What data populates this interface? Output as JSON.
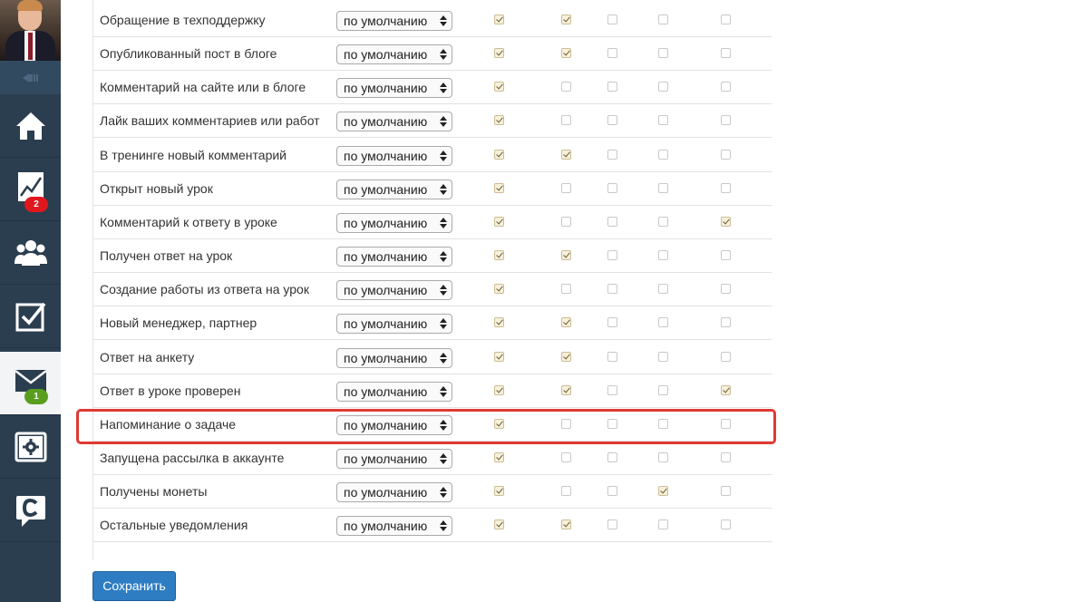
{
  "sidebar": {
    "badges": {
      "stats": "2",
      "messages": "1"
    },
    "items": [
      {
        "name": "home",
        "icon": "home-icon"
      },
      {
        "name": "statistics",
        "icon": "chart-icon"
      },
      {
        "name": "users",
        "icon": "users-icon"
      },
      {
        "name": "tasks",
        "icon": "checkbox-icon"
      },
      {
        "name": "messages",
        "icon": "envelope-icon"
      },
      {
        "name": "settings",
        "icon": "gear-screen-icon"
      },
      {
        "name": "chat",
        "icon": "chat-logo-icon"
      }
    ]
  },
  "notifications": {
    "rows": [
      {
        "label": "Обращение в техподдержку",
        "select": "по умолчанию",
        "checks": [
          true,
          true,
          false,
          false,
          false
        ]
      },
      {
        "label": "Опубликованный пост в блоге",
        "select": "по умолчанию",
        "checks": [
          true,
          true,
          false,
          false,
          false
        ]
      },
      {
        "label": "Комментарий на сайте или в блоге",
        "select": "по умолчанию",
        "checks": [
          true,
          false,
          false,
          false,
          false
        ]
      },
      {
        "label": "Лайк ваших комментариев или работ",
        "select": "по умолчанию",
        "checks": [
          true,
          false,
          false,
          false,
          false
        ]
      },
      {
        "label": "В тренинге новый комментарий",
        "select": "по умолчанию",
        "checks": [
          true,
          true,
          false,
          false,
          false
        ]
      },
      {
        "label": "Открыт новый урок",
        "select": "по умолчанию",
        "checks": [
          true,
          false,
          false,
          false,
          false
        ]
      },
      {
        "label": "Комментарий к ответу в уроке",
        "select": "по умолчанию",
        "checks": [
          true,
          false,
          false,
          false,
          true
        ]
      },
      {
        "label": "Получен ответ на урок",
        "select": "по умолчанию",
        "checks": [
          true,
          true,
          false,
          false,
          false
        ]
      },
      {
        "label": "Создание работы из ответа на урок",
        "select": "по умолчанию",
        "checks": [
          true,
          false,
          false,
          false,
          false
        ]
      },
      {
        "label": "Новый менеджер, партнер",
        "select": "по умолчанию",
        "checks": [
          true,
          true,
          false,
          false,
          false
        ]
      },
      {
        "label": "Ответ на анкету",
        "select": "по умолчанию",
        "checks": [
          true,
          true,
          false,
          false,
          false
        ]
      },
      {
        "label": "Ответ в уроке проверен",
        "select": "по умолчанию",
        "checks": [
          true,
          true,
          false,
          false,
          true
        ]
      },
      {
        "label": "Напоминание о задаче",
        "select": "по умолчанию",
        "checks": [
          true,
          false,
          false,
          false,
          false
        ]
      },
      {
        "label": "Запущена рассылка в аккаунте",
        "select": "по умолчанию",
        "checks": [
          true,
          false,
          false,
          false,
          false
        ]
      },
      {
        "label": "Получены монеты",
        "select": "по умолчанию",
        "checks": [
          true,
          false,
          false,
          true,
          false
        ]
      },
      {
        "label": "Остальные уведомления",
        "select": "по умолчанию",
        "checks": [
          true,
          true,
          false,
          false,
          false
        ]
      }
    ]
  },
  "actions": {
    "save_label": "Сохранить"
  },
  "colors": {
    "sidebar": "#2b3e50",
    "primary": "#2e7dc3",
    "highlight": "#e03a33",
    "badge_red": "#e0181e",
    "badge_green": "#5a9e1e"
  }
}
